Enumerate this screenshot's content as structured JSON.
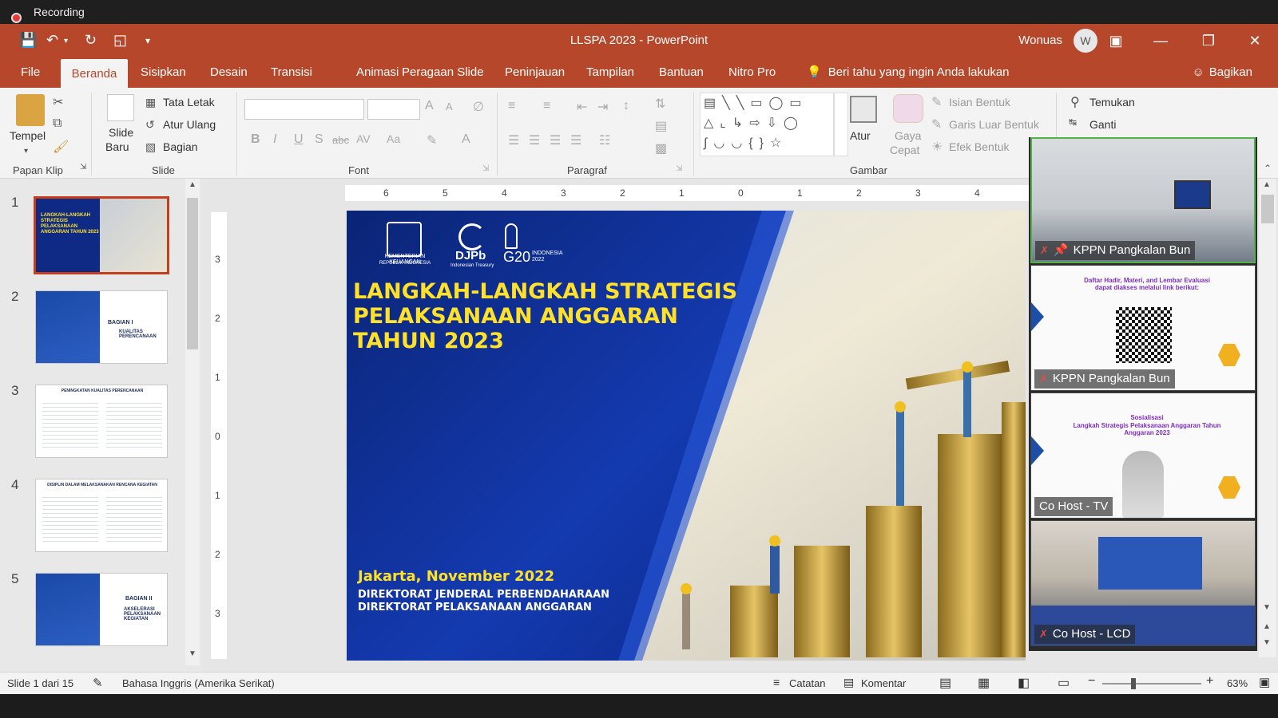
{
  "recording": {
    "label": "Recording"
  },
  "window": {
    "title": "LLSPA 2023  -  PowerPoint",
    "user": "Wonuas",
    "avatar_initial": "W"
  },
  "tabs": [
    "File",
    "Beranda",
    "Sisipkan",
    "Desain",
    "Transisi",
    "Animasi",
    "Peragaan Slide",
    "Peninjauan",
    "Tampilan",
    "Bantuan",
    "Nitro Pro"
  ],
  "active_tab": "Beranda",
  "tell_me": "Beri tahu yang ingin Anda lakukan",
  "share": "Bagikan",
  "ribbon": {
    "clipboard": {
      "paste": "Tempel",
      "group": "Papan Klip"
    },
    "slides": {
      "new_slide_1": "Slide",
      "new_slide_2": "Baru",
      "layout": "Tata Letak",
      "reset": "Atur Ulang",
      "section": "Bagian",
      "group": "Slide"
    },
    "font": {
      "group": "Font",
      "bold": "B",
      "italic": "I",
      "underline": "U",
      "strike": "S",
      "strike2": "abc",
      "spacing": "AV",
      "case": "Aa",
      "grow": "A",
      "shrink": "A",
      "color": "A"
    },
    "paragraph": {
      "group": "Paragraf"
    },
    "drawing": {
      "arrange": "Atur",
      "quick_styles_1": "Gaya",
      "quick_styles_2": "Cepat",
      "shape_fill": "Isian Bentuk",
      "shape_outline": "Garis Luar Bentuk",
      "shape_effects": "Efek Bentuk",
      "group": "Gambar"
    },
    "editing": {
      "find": "Temukan",
      "replace": "Ganti"
    }
  },
  "thumbnails": [
    {
      "num": "1",
      "title": "LANGKAH-LANGKAH STRATEGIS PELAKSANAAN ANGGARAN TAHUN 2023"
    },
    {
      "num": "2",
      "title": "BAGIAN I",
      "subtitle": "KUALITAS PERENCANAAN"
    },
    {
      "num": "3",
      "title": "PENINGKATAN KUALITAS PERENCANAAN"
    },
    {
      "num": "4",
      "title": "DISIPLIN DALAM MELAKSANAKAN RENCANA KEGIATAN"
    },
    {
      "num": "5",
      "title": "BAGIAN II",
      "subtitle": "AKSELERASI PELAKSANAAN KEGIATAN"
    }
  ],
  "ruler": {
    "h": [
      "6",
      "5",
      "4",
      "3",
      "2",
      "1",
      "0",
      "1",
      "2",
      "3",
      "4"
    ],
    "v": [
      "3",
      "2",
      "1",
      "0",
      "1",
      "2",
      "3"
    ]
  },
  "slide": {
    "logos": {
      "kemenkeu_1": "KEMENTERIAN KEUANGAN",
      "kemenkeu_2": "REPUBLIK INDONESIA",
      "djpb": "DJPb",
      "djpb_sub": "Indonesian Treasury",
      "g20": "G20",
      "g20_sub": "INDONESIA 2022"
    },
    "title_lines": [
      "LANGKAH-LANGKAH STRATEGIS",
      "PELAKSANAAN ANGGARAN",
      "TAHUN 2023"
    ],
    "date": "Jakarta, November 2022",
    "org_lines": [
      "DIREKTORAT JENDERAL PERBENDAHARAAN",
      "DIREKTORAT PELAKSANAAN ANGGARAN"
    ],
    "title_color": "#ffe12a"
  },
  "videos": [
    {
      "name": "KPPN Pangkalan Bun",
      "muted": true,
      "pinned": true
    },
    {
      "name": "KPPN Pangkalan Bun",
      "muted": true,
      "pinned": false,
      "text": "Daftar Hadir, Materi, and Lembar Evaluasi dapat diakses melalui link berikut:"
    },
    {
      "name": "Co Host - TV",
      "muted": false,
      "pinned": false,
      "text_1": "Sosialisasi",
      "text_2": "Langkah Strategis Pelaksanaan Anggaran Tahun Anggaran 2023"
    },
    {
      "name": "Co Host - LCD",
      "muted": true,
      "pinned": false
    }
  ],
  "status": {
    "slide": "Slide 1 dari 15",
    "language": "Bahasa Inggris (Amerika Serikat)",
    "notes": "Catatan",
    "comments": "Komentar",
    "zoom": "63%",
    "zoom_level": 0.63
  }
}
